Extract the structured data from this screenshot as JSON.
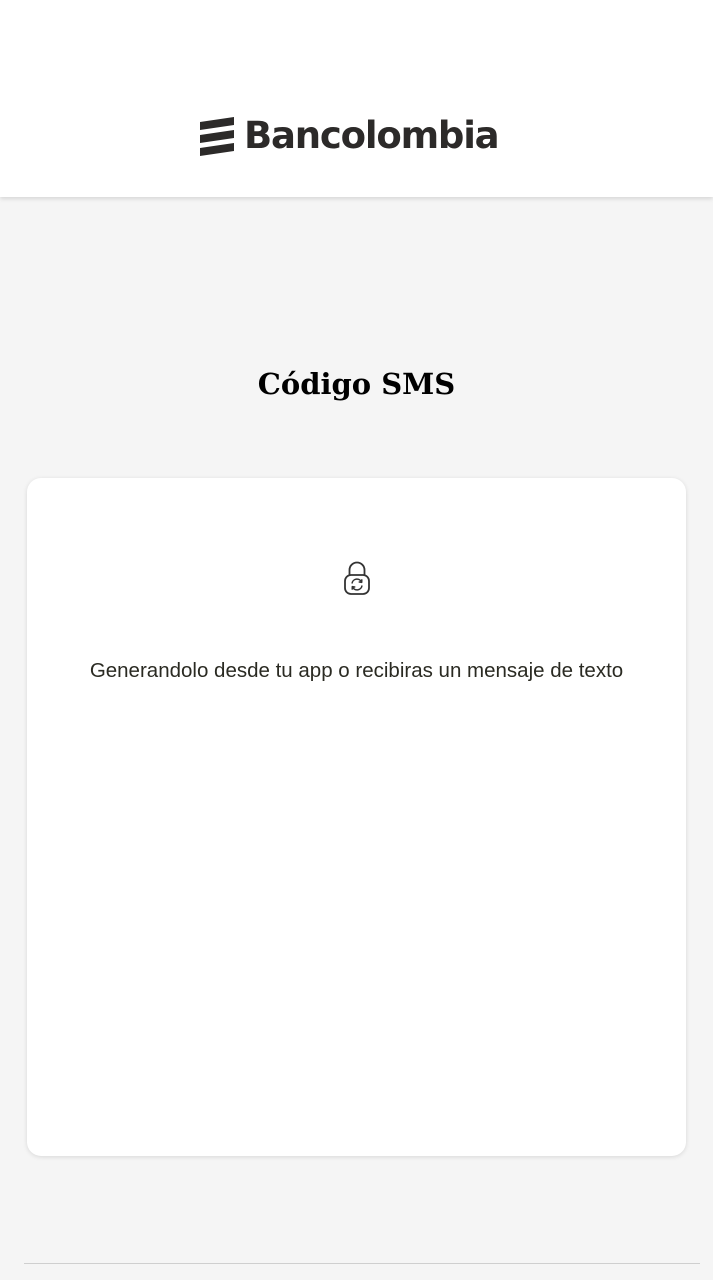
{
  "header": {
    "logo_text": "Bancolombia"
  },
  "main": {
    "title": "Código SMS",
    "card": {
      "icon": "lock-refresh-icon",
      "message": "Generandolo desde tu app o recibiras un mensaje de texto"
    }
  },
  "colors": {
    "page_background": "#f5f5f5",
    "card_background": "#ffffff",
    "logo": "#2c2a29",
    "title": "#000000",
    "message": "#2a2a22"
  }
}
